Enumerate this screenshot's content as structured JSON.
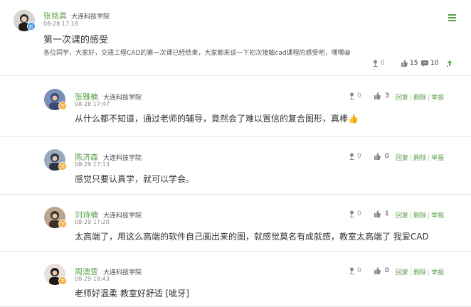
{
  "post": {
    "author": "张铭真",
    "school": "大连科技学院",
    "time": "08-28 17:18",
    "badge": "校",
    "title": "第一次课的感受",
    "body": "各位同学，大家好，交通工程CAD的第一次课已经结束，大家都来谈一下初次接触cad课程的感受吧，嘿嘿😁",
    "stats": {
      "flowers": "0",
      "likes": "15",
      "comments": "10"
    }
  },
  "actions": {
    "reply": "回复",
    "delete": "删除",
    "report": "举报",
    "separator": "|"
  },
  "replies": [
    {
      "author": "张雅楠",
      "school": "大连科技学院",
      "time": "08-28 17:47",
      "badge": "学",
      "content": "从什么都不知道，通过老师的辅导，竟然会了难以置信的复合图形，真棒👍",
      "flowers": "0",
      "likes": "3"
    },
    {
      "author": "陈济森",
      "school": "大连科技学院",
      "time": "08-29 17:13",
      "badge": "学",
      "content": "感觉只要认真学，就可以学会。",
      "flowers": "0",
      "likes": "0"
    },
    {
      "author": "刘诗楠",
      "school": "大连科技学院",
      "time": "08-29 17:20",
      "badge": "学",
      "content": "太高端了，用这么高端的软件自己画出来的图，就感觉莫名有成就感，教室太高端了 我爱CAD",
      "flowers": "0",
      "likes": "1"
    },
    {
      "author": "周澳萱",
      "school": "大连科技学院",
      "time": "08-29 18:43",
      "badge": "学",
      "content": "老师好温柔 教室好舒适 [呲牙]",
      "flowers": "0",
      "likes": "0"
    }
  ],
  "colors": {
    "accent": "#5aa04a",
    "teacher_badge": "#2f8ee0",
    "student_badge": "#f5a623"
  }
}
